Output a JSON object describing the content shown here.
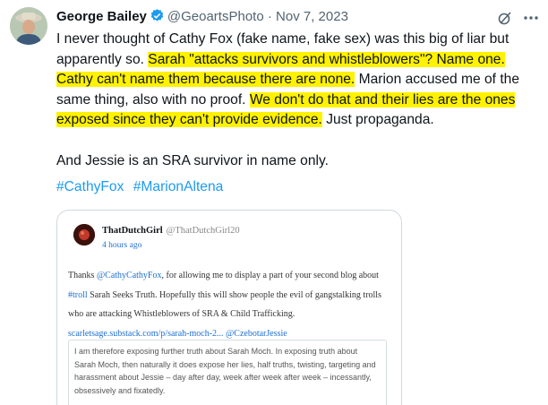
{
  "tweet": {
    "author_name": "George Bailey",
    "author_handle": "@GeoartsPhoto",
    "separator": "·",
    "date": "Nov 7, 2023",
    "paragraph1": [
      {
        "text": "I never thought of Cathy Fox (fake name, fake sex) was this big of liar but apparently so. ",
        "highlight": false
      },
      {
        "text": "Sarah \"attacks survivors and whistleblowers\"?  Name one. Cathy can't name them because there are none.",
        "highlight": true
      },
      {
        "text": " Marion accused me of the same thing, also with no proof. ",
        "highlight": false
      },
      {
        "text": "We don't do that and their lies are the ones exposed since they can't provide evidence.",
        "highlight": true
      },
      {
        "text": " Just propaganda.",
        "highlight": false
      }
    ],
    "paragraph2": "And Jessie is an SRA survivor in name only.",
    "hashtag1": "#CathyFox",
    "hashtag2": "#MarionAltena",
    "icons": {
      "verified": "verified-badge-icon",
      "grok": "grok-icon",
      "more": "more-options-icon"
    },
    "colors": {
      "highlight": "#fff200",
      "link": "#1d9bf0",
      "verified": "#1d9bf0"
    }
  },
  "embedded": {
    "name": "ThatDutchGirl",
    "handle": "@ThatDutchGirl20",
    "time": "4 hours ago",
    "body_pre": "Thanks ",
    "mention1": "@CathyCathyFox",
    "body_mid": ", for allowing me to display a part of your second blog about ",
    "hashtag": "#troll",
    "body_post": " Sarah Seeks Truth. Hopefully this will show people the evil of gangstalking trolls who are attacking Whistleblowers of SRA & Child Trafficking.",
    "link": "scarletsage.substack.com/p/sarah-moch-2...",
    "mention2": "@CzebotarJessie",
    "quote": "I am therefore exposing further truth about Sarah Moch. In exposing truth about Sarah Moch, then naturally it does expose her lies, half truths, twisting, targeting and harassment about Jessie – day after day, week after week after week – incessantly, obsessively and fixatedly."
  }
}
